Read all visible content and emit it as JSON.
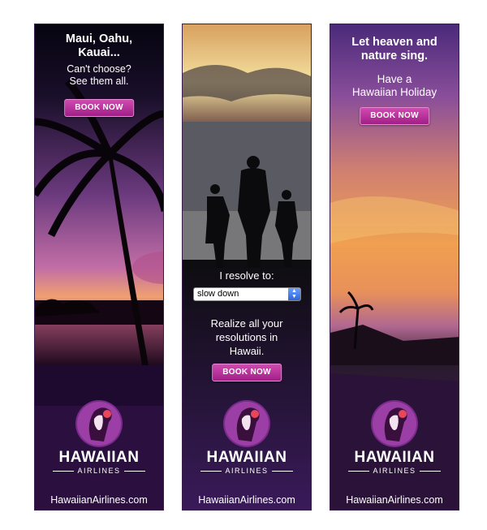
{
  "banner1": {
    "headline": [
      "Maui, Oahu,",
      "Kauai..."
    ],
    "subtext": [
      "Can't choose?",
      "See them all."
    ],
    "button": "BOOK NOW",
    "brand": "HAWAIIAN",
    "brand_sub": "AIRLINES",
    "url": "HawaiianAirlines.com"
  },
  "banner2": {
    "prompt": "I resolve to:",
    "select_value": "slow down",
    "message": [
      "Realize all your",
      "resolutions in",
      "Hawaii."
    ],
    "button": "BOOK NOW",
    "brand": "HAWAIIAN",
    "brand_sub": "AIRLINES",
    "url": "HawaiianAirlines.com"
  },
  "banner3": {
    "headline": [
      "Let heaven and",
      "nature sing."
    ],
    "subtext": [
      "Have a",
      "Hawaiian Holiday"
    ],
    "button": "BOOK NOW",
    "brand": "HAWAIIAN",
    "brand_sub": "AIRLINES",
    "url": "HawaiianAirlines.com"
  },
  "colors": {
    "button": "#b0308f",
    "purple_dark": "#2b0f3e",
    "accent_pink": "#d04ab2"
  },
  "icons": [
    "hawaiian-airlines-logo-icon",
    "select-arrows-icon"
  ]
}
